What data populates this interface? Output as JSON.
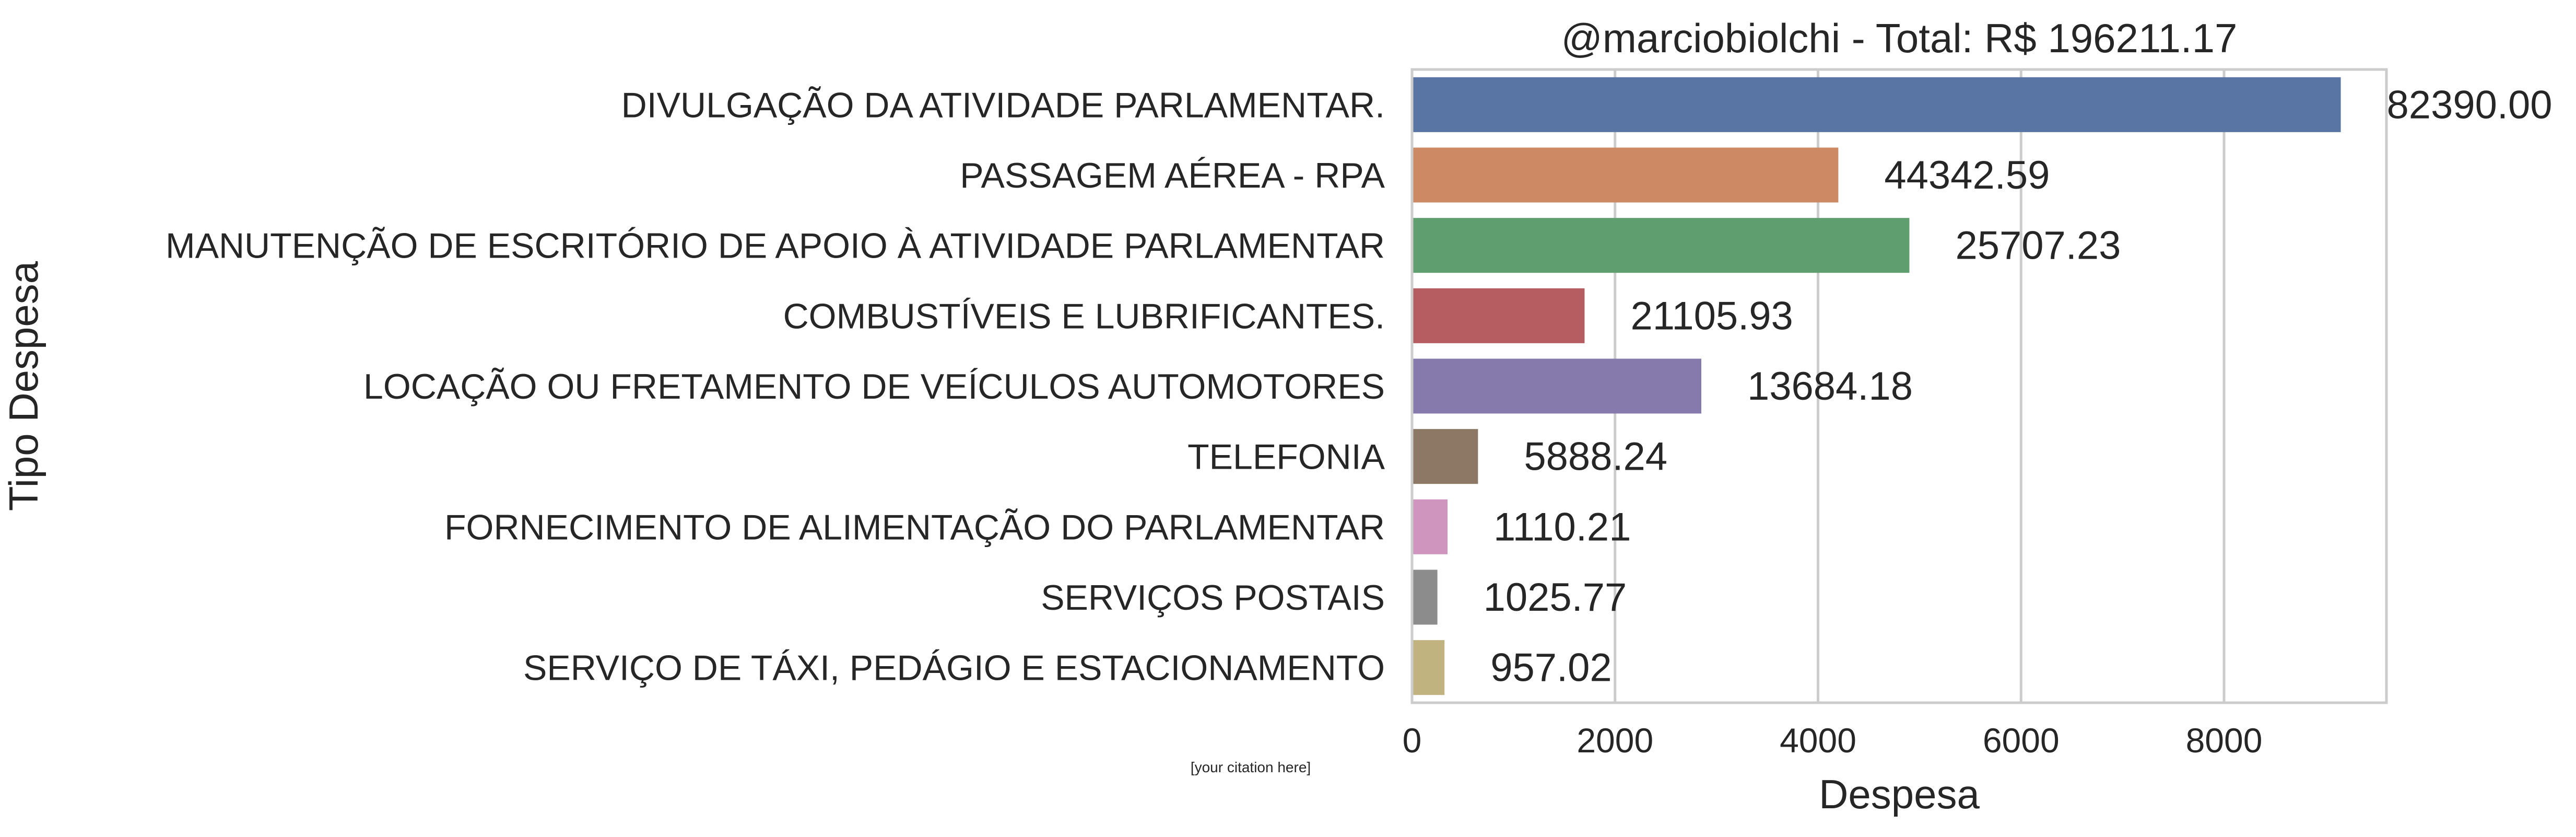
{
  "chart_data": {
    "type": "bar",
    "orientation": "horizontal",
    "title": "@marciobiolchi - Total: R$ 196211.17",
    "xlabel": "Despesa",
    "ylabel": "Tipo Despesa",
    "xlim": [
      0,
      9600
    ],
    "xticks": [
      0,
      2000,
      4000,
      6000,
      8000
    ],
    "grid": true,
    "categories": [
      "DIVULGAÇÃO DA ATIVIDADE PARLAMENTAR.",
      "PASSAGEM AÉREA - RPA",
      "MANUTENÇÃO DE ESCRITÓRIO DE APOIO À ATIVIDADE PARLAMENTAR",
      "COMBUSTÍVEIS E LUBRIFICANTES.",
      "LOCAÇÃO OU FRETAMENTO DE VEÍCULOS AUTOMOTORES",
      "TELEFONIA",
      "FORNECIMENTO DE ALIMENTAÇÃO DO PARLAMENTAR",
      "SERVIÇOS POSTAIS",
      "SERVIÇO DE TÁXI, PEDÁGIO E ESTACIONAMENTO"
    ],
    "values": [
      9150,
      4200,
      4900,
      1700,
      2850,
      650,
      350,
      250,
      320
    ],
    "data_labels": [
      "82390.00",
      "44342.59",
      "25707.23",
      "21105.93",
      "13684.18",
      "5888.24",
      "1110.21",
      "1025.77",
      "957.02"
    ],
    "colors": [
      "#5875a4",
      "#cc8963",
      "#5f9e6e",
      "#b55d60",
      "#857aab",
      "#8d7866",
      "#d095bf",
      "#8c8c8c",
      "#c1b37f"
    ]
  },
  "footer": {
    "citation": "[your citation here]"
  }
}
